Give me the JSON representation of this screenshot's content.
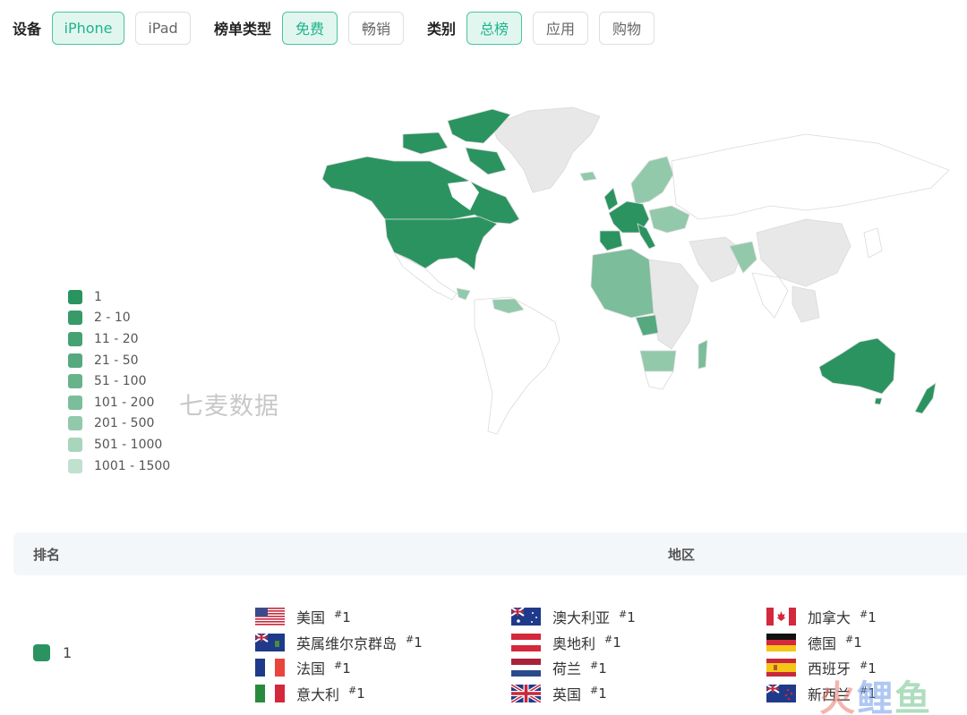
{
  "filters": {
    "device": {
      "label": "设备",
      "options": [
        "iPhone",
        "iPad"
      ],
      "selected": "iPhone"
    },
    "chart_type": {
      "label": "榜单类型",
      "options": [
        "免费",
        "畅销"
      ],
      "selected": "免费"
    },
    "category": {
      "label": "类别",
      "options": [
        "总榜",
        "应用",
        "购物"
      ],
      "selected": "总榜"
    }
  },
  "colors": {
    "accent": "#1fb48a",
    "no_data": "#e8e8e8",
    "rank_1": "#2b9360"
  },
  "legend": [
    {
      "label": "1",
      "color": "#2b9360"
    },
    {
      "label": "2 - 10",
      "color": "#389a68"
    },
    {
      "label": "11 - 20",
      "color": "#46a173"
    },
    {
      "label": "21 - 50",
      "color": "#56a97f"
    },
    {
      "label": "51 - 100",
      "color": "#68b28c"
    },
    {
      "label": "101 - 200",
      "color": "#7cbd9b"
    },
    {
      "label": "201 - 500",
      "color": "#92c9ab"
    },
    {
      "label": "501 - 1000",
      "color": "#a8d5bc"
    },
    {
      "label": "1001 - 1500",
      "color": "#bfe1ce"
    }
  ],
  "watermark": "七麦数据",
  "table": {
    "headers": {
      "rank": "排名",
      "region": "地区"
    },
    "rows": [
      {
        "rank": "1",
        "regions": [
          [
            {
              "name": "美国",
              "rank": "1",
              "flag": "us"
            },
            {
              "name": "英属维尔京群岛",
              "rank": "1",
              "flag": "vg"
            },
            {
              "name": "法国",
              "rank": "1",
              "flag": "fr"
            },
            {
              "name": "意大利",
              "rank": "1",
              "flag": "it"
            }
          ],
          [
            {
              "name": "澳大利亚",
              "rank": "1",
              "flag": "au"
            },
            {
              "name": "奥地利",
              "rank": "1",
              "flag": "at"
            },
            {
              "name": "荷兰",
              "rank": "1",
              "flag": "nl"
            },
            {
              "name": "英国",
              "rank": "1",
              "flag": "gb"
            }
          ],
          [
            {
              "name": "加拿大",
              "rank": "1",
              "flag": "ca"
            },
            {
              "name": "德国",
              "rank": "1",
              "flag": "de"
            },
            {
              "name": "西班牙",
              "rank": "1",
              "flag": "es"
            },
            {
              "name": "新西兰",
              "rank": "1",
              "flag": "nz"
            }
          ]
        ]
      }
    ]
  },
  "brand_watermark": [
    "火",
    "鲤",
    "鱼"
  ]
}
